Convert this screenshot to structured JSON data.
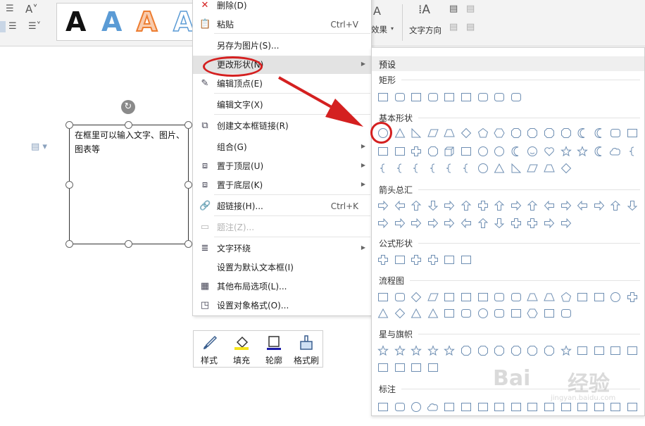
{
  "ribbon": {
    "wordart_sample": "A",
    "text_effect_label": "效果",
    "text_direction_label": "文字方向"
  },
  "document": {
    "textbox_text": "在框里可以输入文字、图片、图表等"
  },
  "context_menu": {
    "items": [
      {
        "label": "删除(D)",
        "shortcut": "",
        "icon": "delete-x-icon"
      },
      {
        "label": "粘贴",
        "shortcut": "Ctrl+V",
        "icon": "paste-icon"
      },
      {
        "label": "另存为图片(S)...",
        "shortcut": "",
        "icon": ""
      },
      {
        "label": "更改形状(N)",
        "shortcut": "",
        "icon": "",
        "submenu": true
      },
      {
        "label": "编辑顶点(E)",
        "shortcut": "",
        "icon": "edit-points-icon"
      },
      {
        "label": "编辑文字(X)",
        "shortcut": "",
        "icon": ""
      },
      {
        "label": "创建文本框链接(R)",
        "shortcut": "",
        "icon": "link-textbox-icon"
      },
      {
        "label": "组合(G)",
        "shortcut": "",
        "icon": "",
        "submenu": true
      },
      {
        "label": "置于顶层(U)",
        "shortcut": "",
        "icon": "bring-front-icon",
        "submenu": true
      },
      {
        "label": "置于底层(K)",
        "shortcut": "",
        "icon": "send-back-icon",
        "submenu": true
      },
      {
        "label": "超链接(H)...",
        "shortcut": "Ctrl+K",
        "icon": "hyperlink-icon"
      },
      {
        "label": "题注(Z)...",
        "shortcut": "",
        "icon": "caption-icon",
        "disabled": true
      },
      {
        "label": "文字环绕",
        "shortcut": "",
        "icon": "text-wrap-icon",
        "submenu": true
      },
      {
        "label": "设置为默认文本框(I)",
        "shortcut": "",
        "icon": ""
      },
      {
        "label": "其他布局选项(L)...",
        "shortcut": "",
        "icon": "layout-options-icon"
      },
      {
        "label": "设置对象格式(O)...",
        "shortcut": "",
        "icon": "format-object-icon"
      }
    ]
  },
  "mini_toolbar": {
    "buttons": [
      {
        "label": "样式",
        "icon": "brush-style-icon"
      },
      {
        "label": "填充",
        "icon": "fill-bucket-icon"
      },
      {
        "label": "轮廓",
        "icon": "outline-icon"
      },
      {
        "label": "格式刷",
        "icon": "format-painter-icon"
      }
    ]
  },
  "shape_panel": {
    "title": "预设",
    "sections": [
      {
        "name": "矩形",
        "count": 9
      },
      {
        "name": "基本形状",
        "count": 44
      },
      {
        "name": "箭头总汇",
        "count": 28
      },
      {
        "name": "公式形状",
        "count": 6
      },
      {
        "name": "流程图",
        "count": 28
      },
      {
        "name": "星与旗帜",
        "count": 20
      },
      {
        "name": "标注",
        "count": 16
      }
    ]
  },
  "watermark": {
    "brand": "Bai",
    "brand_cn": "经验",
    "sub": "jingyan.baidu.com"
  },
  "colors": {
    "annotation_red": "#d42020",
    "shape_stroke": "#6f8fb3",
    "menu_highlight": "#e3e3e3"
  }
}
